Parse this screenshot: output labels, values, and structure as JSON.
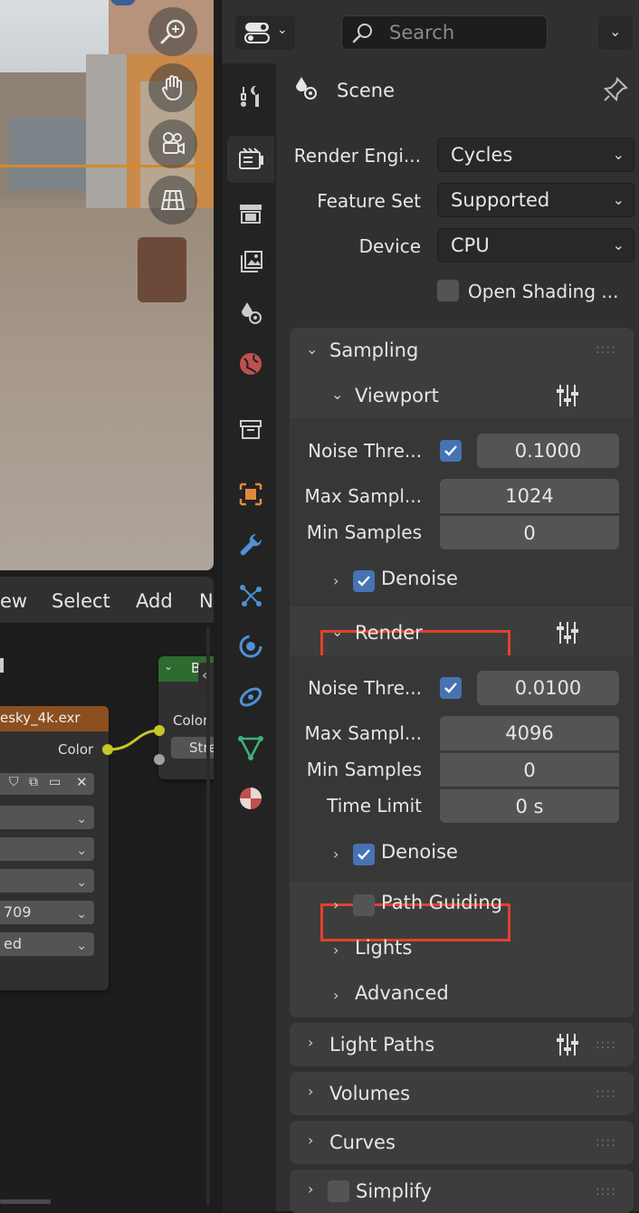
{
  "viewport": {
    "nav_buttons": [
      "zoom-icon",
      "hand-icon",
      "camera-icon",
      "grid-icon"
    ]
  },
  "node_editor": {
    "menu": {
      "view": "ew",
      "select": "Select",
      "add": "Add",
      "node": "N"
    },
    "image_node": {
      "title": "esky_4k.exr",
      "output": "Color",
      "fields": [
        "",
        "",
        "",
        "709",
        "ed"
      ]
    },
    "background_node": {
      "title": "Bac",
      "input_color": "Color",
      "input_strength": "Stre"
    }
  },
  "properties": {
    "search_placeholder": "Search",
    "context_title": "Scene",
    "render_engine_label": "Render Engi...",
    "render_engine_value": "Cycles",
    "feature_set_label": "Feature Set",
    "feature_set_value": "Supported",
    "device_label": "Device",
    "device_value": "CPU",
    "osl_label": "Open Shading ...",
    "sampling": {
      "title": "Sampling",
      "viewport": {
        "title": "Viewport",
        "noise_label": "Noise Thre...",
        "noise_value": "0.1000",
        "max_label": "Max Sampl...",
        "max_value": "1024",
        "min_label": "Min Samples",
        "min_value": "0",
        "denoise_label": "Denoise"
      },
      "render": {
        "title": "Render",
        "noise_label": "Noise Thre...",
        "noise_value": "0.0100",
        "max_label": "Max Sampl...",
        "max_value": "4096",
        "min_label": "Min Samples",
        "min_value": "0",
        "time_label": "Time Limit",
        "time_value": "0 s",
        "denoise_label": "Denoise"
      },
      "path_guiding": "Path Guiding",
      "lights": "Lights",
      "advanced": "Advanced"
    },
    "light_paths": "Light Paths",
    "volumes": "Volumes",
    "curves": "Curves",
    "simplify": "Simplify"
  },
  "colors": {
    "highlight": "#e2422b",
    "checkbox_on": "#4772b3",
    "node_header_image": "#8c4f1f",
    "node_header_shader": "#2f6a2f"
  }
}
